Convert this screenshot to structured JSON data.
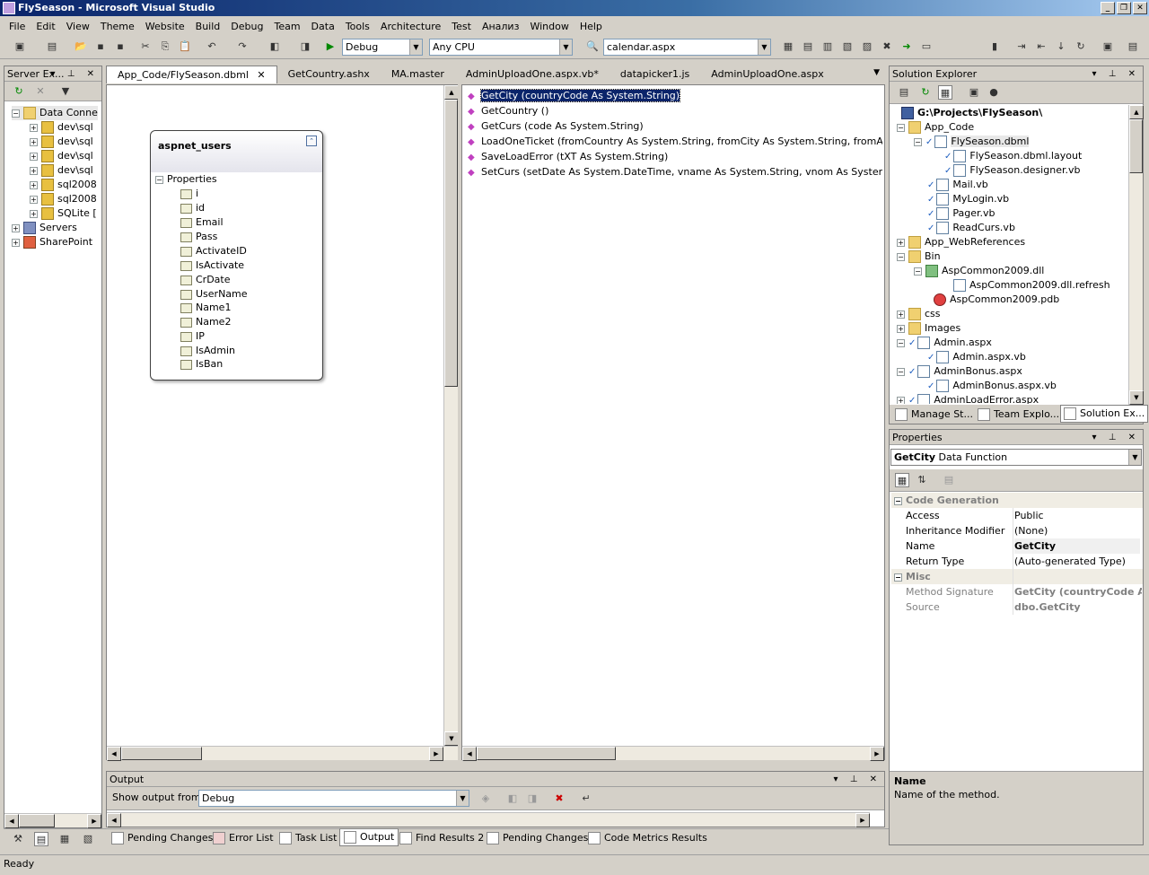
{
  "window": {
    "title": "FlySeason - Microsoft Visual Studio"
  },
  "menu": [
    "File",
    "Edit",
    "View",
    "Theme",
    "Website",
    "Build",
    "Debug",
    "Team",
    "Data",
    "Tools",
    "Architecture",
    "Test",
    "Анализ",
    "Window",
    "Help"
  ],
  "toolbar": {
    "config": "Debug",
    "platform": "Any CPU",
    "find": "calendar.aspx"
  },
  "server_explorer": {
    "title": "Server Ex...",
    "items": [
      "Data Conne",
      "dev\\sql",
      "dev\\sql",
      "dev\\sql",
      "dev\\sql",
      "sql2008",
      "sql2008",
      "SQLite [",
      "Servers",
      "SharePoint"
    ]
  },
  "doc_tabs": [
    "App_Code/FlySeason.dbml",
    "GetCountry.ashx",
    "MA.master",
    "AdminUploadOne.aspx.vb*",
    "datapicker1.js",
    "AdminUploadOne.aspx"
  ],
  "entity": {
    "name": "aspnet_users",
    "section": "Properties",
    "props": [
      "i",
      "id",
      "Email",
      "Pass",
      "ActivateID",
      "IsActivate",
      "CrDate",
      "UserName",
      "Name1",
      "Name2",
      "IP",
      "IsAdmin",
      "IsBan"
    ]
  },
  "methods": [
    "GetCity (countryCode As System.String)",
    "GetCountry ()",
    "GetCurs (code As System.String)",
    "LoadOneTicket (fromCountry As System.String, fromCity As System.String, fromAirport As Sy",
    "SaveLoadError (tXT As System.String)",
    "SetCurs (setDate As System.DateTime, vname As System.String, vnom As System.Decimal, v"
  ],
  "solution_explorer": {
    "title": "Solution Explorer",
    "items": [
      "G:\\Projects\\FlySeason\\",
      "App_Code",
      "FlySeason.dbml",
      "FlySeason.dbml.layout",
      "FlySeason.designer.vb",
      "Mail.vb",
      "MyLogin.vb",
      "Pager.vb",
      "ReadCurs.vb",
      "App_WebReferences",
      "Bin",
      "AspCommon2009.dll",
      "AspCommon2009.dll.refresh",
      "AspCommon2009.pdb",
      "css",
      "Images",
      "Admin.aspx",
      "Admin.aspx.vb",
      "AdminBonus.aspx",
      "AdminBonus.aspx.vb",
      "AdminLoadError.aspx"
    ],
    "tabs": [
      "Manage St...",
      "Team Explo...",
      "Solution Ex..."
    ]
  },
  "properties": {
    "title": "Properties",
    "object": "GetCity",
    "object_type": "Data Function",
    "cat1": "Code Generation",
    "rows1": [
      [
        "Access",
        "Public"
      ],
      [
        "Inheritance Modifier",
        "(None)"
      ],
      [
        "Name",
        "GetCity"
      ],
      [
        "Return Type",
        "(Auto-generated Type)"
      ]
    ],
    "cat2": "Misc",
    "rows2": [
      [
        "Method Signature",
        "GetCity (countryCode As"
      ],
      [
        "Source",
        "dbo.GetCity"
      ]
    ],
    "desc_title": "Name",
    "desc_text": "Name of the method."
  },
  "output": {
    "title": "Output",
    "show_label": "Show output from:",
    "source": "Debug"
  },
  "bottom_tabs": [
    "Pending Changes",
    "Error List",
    "Task List",
    "Output",
    "Find Results 2",
    "Pending Changes",
    "Code Metrics Results"
  ],
  "status": "Ready"
}
